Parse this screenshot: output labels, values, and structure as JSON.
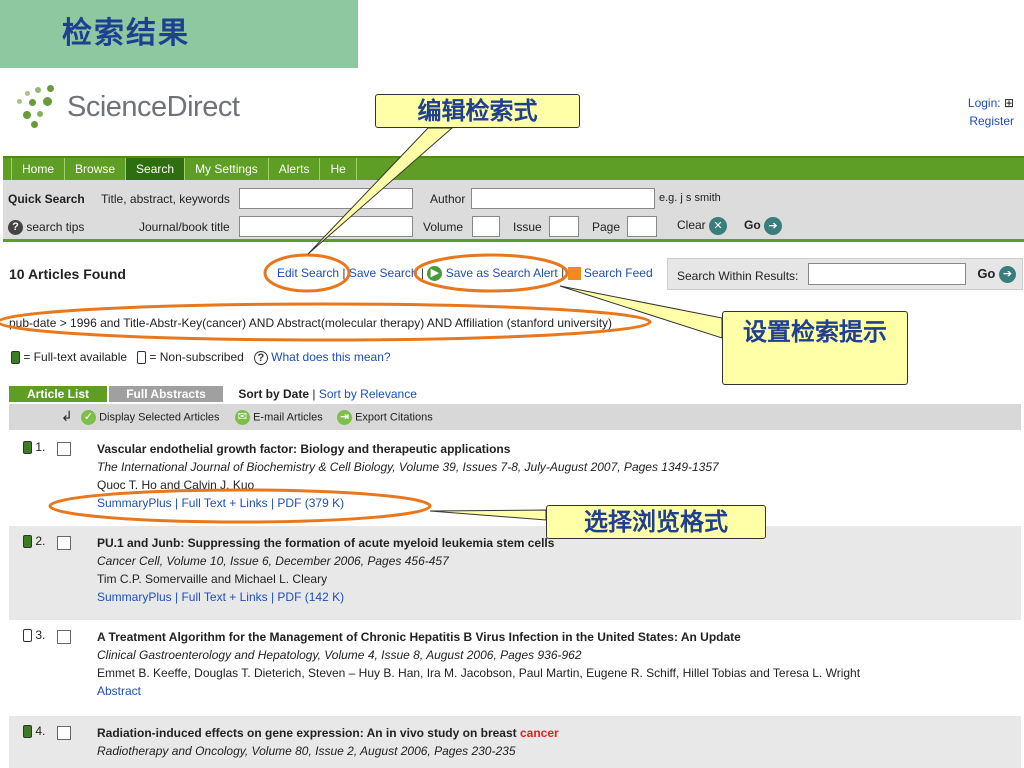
{
  "slide_title": "检索结果",
  "brand": {
    "name": "ScienceDirect",
    "login": "Login:",
    "login_toggle": "⊞",
    "register": "Register"
  },
  "nav": {
    "tabs": [
      "Home",
      "Browse",
      "Search",
      "My Settings",
      "Alerts",
      "He"
    ]
  },
  "quick_search": {
    "label": "Quick Search",
    "field1_label": "Title, abstract, keywords",
    "author_label": "Author",
    "author_hint": "e.g. j s smith",
    "tips": "search tips",
    "journal_label": "Journal/book title",
    "volume_label": "Volume",
    "issue_label": "Issue",
    "page_label": "Page",
    "clear": "Clear",
    "go": "Go"
  },
  "results": {
    "found": "10 Articles Found",
    "edit_search": "Edit Search",
    "save_search": "Save Search",
    "save_alert": "Save as Search Alert",
    "search_feed": "Search Feed",
    "within_label": "Search Within Results:",
    "within_go": "Go",
    "query": "pub-date > 1996 and Title-Abstr-Key(cancer) AND Abstract(molecular therapy) AND Affiliation (stanford university)",
    "legend_full": "= Full-text available",
    "legend_non": "= Non-subscribed",
    "legend_help": "What does this mean?",
    "tab_list": "Article List",
    "tab_abstracts": "Full Abstracts",
    "sort_by_date": "Sort by Date",
    "sort_by_relevance": "Sort by Relevance",
    "display_selected": "Display Selected Articles",
    "email_articles": "E-mail Articles",
    "export": "Export Citations"
  },
  "articles": [
    {
      "num": "1.",
      "title": "Vascular endothelial growth factor: Biology and therapeutic applications",
      "source": "The International Journal of Biochemistry & Cell Biology, Volume 39, Issues 7-8, July-August 2007, Pages 1349-1357",
      "authors": "Quoc T. Ho and Calvin J. Kuo",
      "links": "SummaryPlus | Full Text + Links | PDF (379 K)"
    },
    {
      "num": "2.",
      "title": "PU.1 and Junb: Suppressing the formation of acute myeloid leukemia stem cells",
      "source": "Cancer Cell, Volume 10, Issue 6, December 2006, Pages 456-457",
      "authors": "Tim C.P. Somervaille and Michael L. Cleary",
      "links": "SummaryPlus | Full Text + Links | PDF (142 K)"
    },
    {
      "num": "3.",
      "title": "A Treatment Algorithm for the Management of Chronic Hepatitis B Virus Infection in the United States: An Update",
      "source": "Clinical Gastroenterology and Hepatology, Volume 4, Issue 8, August 2006, Pages 936-962",
      "authors": "Emmet B. Keeffe, Douglas T. Dieterich, Steven – Huy B. Han, Ira M. Jacobson, Paul Martin, Eugene R. Schiff, Hillel Tobias and Teresa L. Wright",
      "links": "Abstract"
    },
    {
      "num": "4.",
      "title": "Radiation-induced effects on gene expression: An in vivo study on breast ",
      "title_highlight": "cancer",
      "source": "Radiotherapy and Oncology, Volume 80, Issue 2, August 2006, Pages 230-235"
    }
  ],
  "callouts": {
    "edit": "编辑检索式",
    "alert": "设置检索提示",
    "format": "选择浏览格式"
  },
  "colors": {
    "brand_green": "#5f9e25",
    "link_blue": "#1d4fb7",
    "callout_fill": "#ffffa8",
    "ellipse": "#e8771e"
  }
}
